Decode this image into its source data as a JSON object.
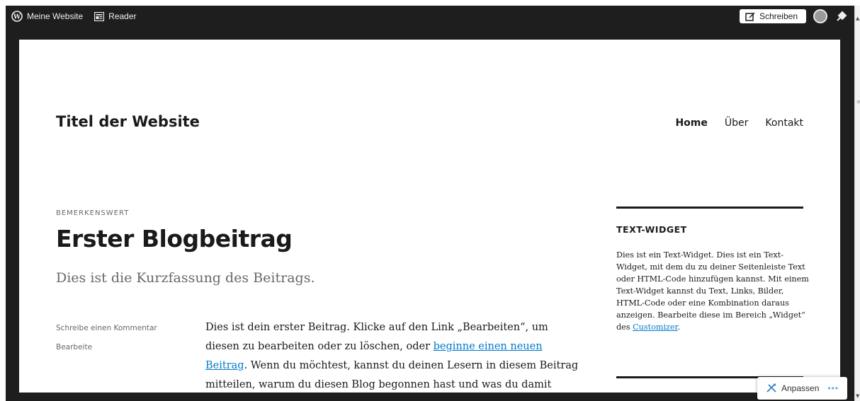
{
  "adminbar": {
    "site_label": "Meine Website",
    "reader_label": "Reader",
    "write_label": "Schreiben"
  },
  "site": {
    "title": "Titel der Website"
  },
  "nav": {
    "items": [
      {
        "label": "Home"
      },
      {
        "label": "Über"
      },
      {
        "label": "Kontakt"
      }
    ]
  },
  "post": {
    "category": "BEMERKENSWERT",
    "title": "Erster Blogbeitrag",
    "excerpt": "Dies ist die Kurzfassung des Beitrags.",
    "meta": {
      "comment_label": "Schreibe einen Kommentar",
      "edit_label": "Bearbeite"
    },
    "content_before_link": "Dies ist dein erster Beitrag. Klicke auf den Link „Bearbeiten“, um diesen zu bearbeiten oder zu löschen, oder ",
    "content_link": "beginne einen neuen Beitrag",
    "content_after_link": ". Wenn du möchtest, kannst du deinen Lesern in diesem Beitrag mitteilen, warum du diesen Blog begonnen hast und was du damit vorhast."
  },
  "widget": {
    "title": "TEXT-WIDGET",
    "text_before_link": "Dies ist ein Text-Widget. Dies ist ein Text-Widget, mit dem du zu deiner Seitenleiste Text oder HTML-Code hinzufügen kannst. Mit einem Text-Widget kannst du Text, Links, Bilder, HTML-Code oder eine Kombination daraus anzeigen. Bearbeite diese im Bereich „Widget“ des ",
    "link": "Customizer",
    "text_after_link": "."
  },
  "customizer_button": {
    "label": "Anpassen",
    "more": "•••"
  },
  "colors": {
    "admin_bg": "#1e1e1e",
    "text": "#1a1a1a",
    "muted": "#686868",
    "link": "#007acc"
  },
  "icons": [
    "wordpress-icon",
    "reader-icon",
    "write-icon",
    "avatar",
    "notification-icon",
    "customize-icon",
    "more-icon"
  ]
}
